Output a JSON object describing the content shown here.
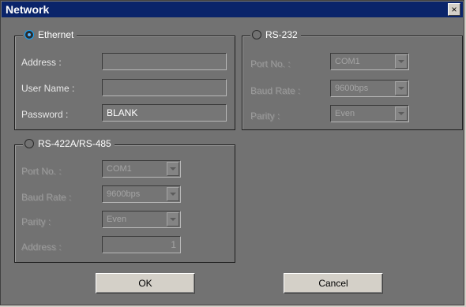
{
  "window": {
    "title": "Network",
    "close_glyph": "×"
  },
  "ethernet": {
    "label": "Ethernet",
    "selected": true,
    "address_label": "Address :",
    "address_value": "",
    "user_label": "User Name :",
    "user_value": "",
    "password_label": "Password :",
    "password_value": "BLANK"
  },
  "rs232": {
    "label": "RS-232",
    "port_label": "Port No. :",
    "port_value": "COM1",
    "baud_label": "Baud Rate :",
    "baud_value": "9600bps",
    "parity_label": "Parity :",
    "parity_value": "Even"
  },
  "rs422": {
    "label": "RS-422A/RS-485",
    "port_label": "Port No. :",
    "port_value": "COM1",
    "baud_label": "Baud Rate :",
    "baud_value": "9600bps",
    "parity_label": "Parity :",
    "parity_value": "Even",
    "address_label": "Address :",
    "address_value": "1"
  },
  "buttons": {
    "ok": "OK",
    "cancel": "Cancel"
  },
  "colors": {
    "titlebar": "#0a246a",
    "body": "#727272",
    "radio_selected": "#52b5ff"
  }
}
